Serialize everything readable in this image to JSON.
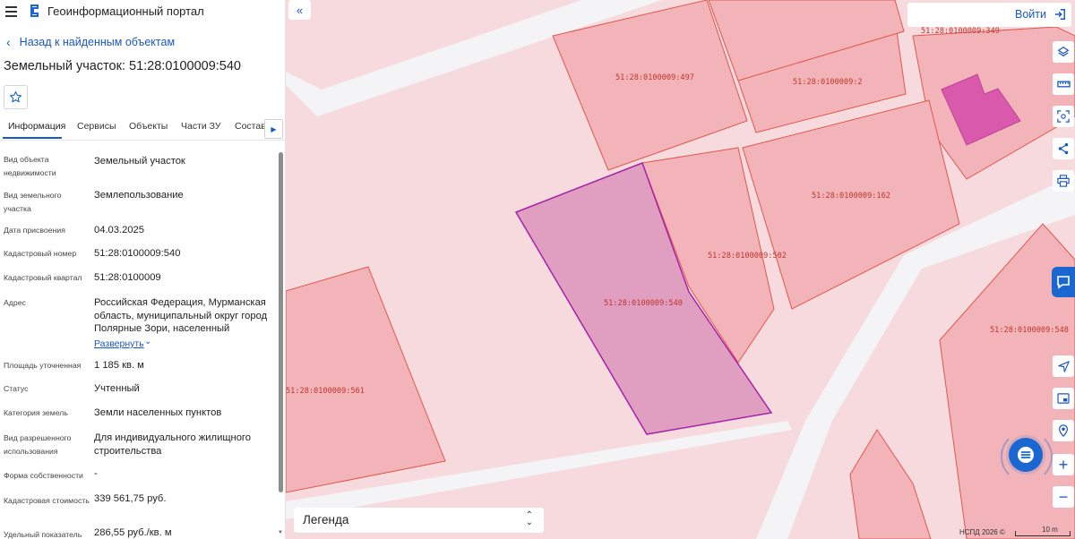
{
  "header": {
    "portal_title": "Геоинформационный портал"
  },
  "nav": {
    "back_label": "Назад к найденным объектам"
  },
  "object": {
    "title": "Земельный участок: 51:28:0100009:540"
  },
  "tabs": [
    {
      "label": "Информация"
    },
    {
      "label": "Сервисы"
    },
    {
      "label": "Объекты"
    },
    {
      "label": "Части ЗУ"
    },
    {
      "label": "Состав"
    }
  ],
  "properties": [
    {
      "key": "Вид объекта недвижимости",
      "value": "Земельный участок"
    },
    {
      "key": "Вид земельного участка",
      "value": "Землепользование"
    },
    {
      "key": "Дата присвоения",
      "value": "04.03.2025"
    },
    {
      "key": "Кадастровый номер",
      "value": "51:28:0100009:540"
    },
    {
      "key": "Кадастровый квартал",
      "value": "51:28:0100009"
    },
    {
      "key": "Адрес",
      "value": "Российская Федерация, Мурманская область, муниципальный округ город Полярные Зори, населенный"
    },
    {
      "key": "Площадь уточненная",
      "value": "1 185 кв. м"
    },
    {
      "key": "Статус",
      "value": "Учтенный"
    },
    {
      "key": "Категория земель",
      "value": "Земли населенных пунктов"
    },
    {
      "key": "Вид разрешенного использования",
      "value": "Для индивидуального жилищного строительства"
    },
    {
      "key": "Форма собственности",
      "value": "-"
    },
    {
      "key": "Кадастровая стоимость",
      "value": "339 561,75 руб."
    },
    {
      "key": "Удельный показатель",
      "value": "286,55 руб./кв. м"
    }
  ],
  "expand_label": "Развернуть",
  "map": {
    "login_label": "Войти",
    "legend_label": "Легенда",
    "copyright": "НСПД 2026 ©",
    "scale_label": "10 m",
    "parcel_labels": [
      "51:28:0100009:497",
      "51:28:0100009:2",
      "51:28:0100009:349",
      "51:28:0100009:162",
      "51:28:0100009:502",
      "51:28:0100009:540",
      "51:28:0100009:548",
      "51:28:0100009:561"
    ],
    "colors": {
      "parcel_fill": "#f3b4b9",
      "parcel_stroke": "#e0574d",
      "selected_fill": "#e09ec0",
      "selected_stroke": "#a523a8",
      "building_fill": "#d95aad",
      "accent": "#1a67d2"
    }
  },
  "icons": [
    "menu-icon",
    "portal-logo-icon",
    "chevron-left-icon",
    "star-icon",
    "chevron-right-icon",
    "double-chevron-left-icon",
    "login-icon",
    "layers-icon",
    "ruler-icon",
    "area-select-icon",
    "share-icon",
    "print-icon",
    "chat-icon",
    "locate-icon",
    "minimap-icon",
    "search-location-icon",
    "zoom-in-icon",
    "zoom-out-icon",
    "menu-lines-icon",
    "select-arrows-icon"
  ]
}
